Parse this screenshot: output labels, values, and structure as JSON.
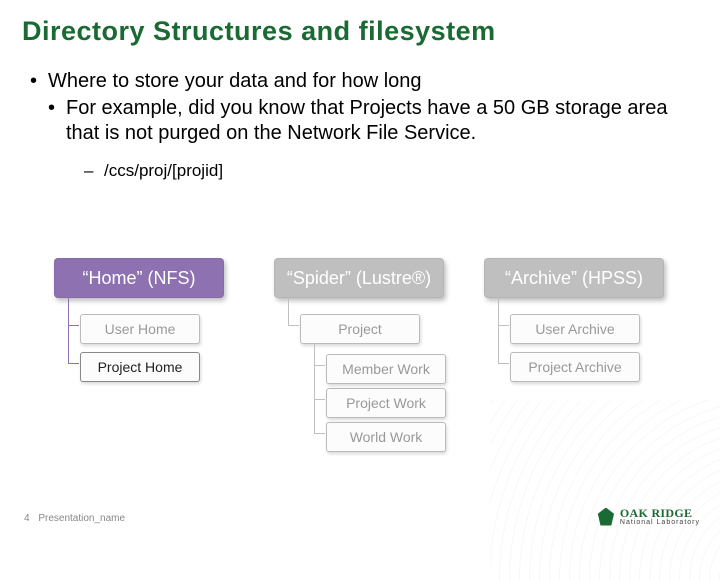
{
  "title": "Directory Structures and filesystem",
  "bullets": {
    "b1": "Where to store your data and for how long",
    "b2": "For example, did you know that Projects have a 50 GB storage area that is not purged on the Network File Service.",
    "dash": "/ccs/proj/[projid]"
  },
  "diagram": {
    "cols": [
      {
        "header": "“Home” (NFS)",
        "style": "purple",
        "items": [
          {
            "label": "User Home",
            "active": false
          },
          {
            "label": "Project Home",
            "active": true
          }
        ]
      },
      {
        "header": "“Spider” (Lustre®)",
        "style": "gray",
        "items": [
          {
            "label": "Project",
            "active": false
          },
          {
            "label": "Member Work",
            "active": false
          },
          {
            "label": "Project Work",
            "active": false
          },
          {
            "label": "World Work",
            "active": false
          }
        ]
      },
      {
        "header": "“Archive” (HPSS)",
        "style": "gray",
        "items": [
          {
            "label": "User Archive",
            "active": false
          },
          {
            "label": "Project Archive",
            "active": false
          }
        ]
      }
    ]
  },
  "footer": {
    "page": "4",
    "name": "Presentation_name"
  },
  "logo": {
    "line1": "OAK RIDGE",
    "line2": "National Laboratory"
  }
}
